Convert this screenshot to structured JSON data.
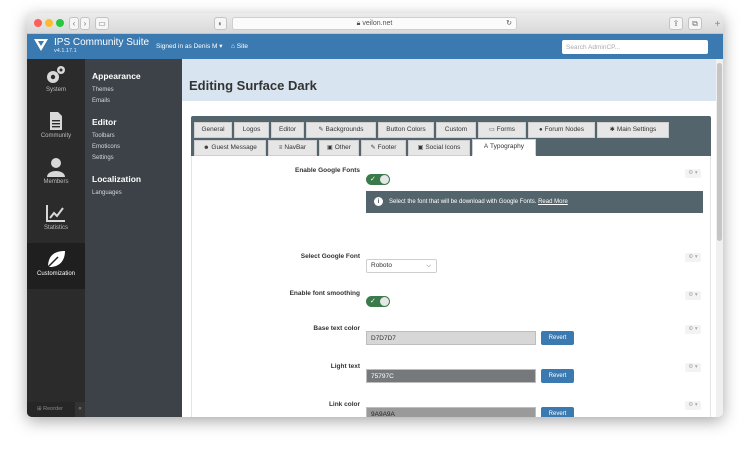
{
  "browser": {
    "url": "veilon.net",
    "tab_plus": "+"
  },
  "header": {
    "brand": "IPS Community Suite",
    "version": "v4.1.17.1",
    "signed_in": "Signed in as Denis M",
    "site_link": "Site",
    "search_placeholder": "Search AdminCP..."
  },
  "rail": {
    "items": [
      {
        "label": "System",
        "icon": "gears-icon"
      },
      {
        "label": "Community",
        "icon": "document-icon"
      },
      {
        "label": "Members",
        "icon": "user-icon"
      },
      {
        "label": "Statistics",
        "icon": "line-chart-icon"
      },
      {
        "label": "Customization",
        "icon": "leaf-icon"
      }
    ],
    "footer": "Reorder",
    "collapse": "«"
  },
  "submenu": {
    "appearance": "Appearance",
    "themes": "Themes",
    "emails": "Emails",
    "editor": "Editor",
    "toolbars": "Toolbars",
    "emoticons": "Emoticons",
    "settings": "Settings",
    "localization": "Localization",
    "languages": "Languages"
  },
  "page": {
    "title": "Editing Surface Dark"
  },
  "tabs": {
    "row1": [
      {
        "label": "General"
      },
      {
        "label": "Logos"
      },
      {
        "label": "Editor"
      },
      {
        "label": "Backgrounds",
        "icon": "✎"
      },
      {
        "label": "Button Colors"
      },
      {
        "label": "Custom"
      },
      {
        "label": "Forms",
        "icon": "▭"
      },
      {
        "label": "Forum Nodes",
        "icon": "●"
      },
      {
        "label": "Main Settings",
        "icon": "✱"
      }
    ],
    "row2": [
      {
        "label": "Guest Message",
        "icon": "☻"
      },
      {
        "label": "NavBar",
        "icon": "≡"
      },
      {
        "label": "Other",
        "icon": "▣"
      },
      {
        "label": "Footer",
        "icon": "✎"
      },
      {
        "label": "Social Icons",
        "icon": "▣"
      },
      {
        "label": "Typography",
        "icon": "A"
      }
    ]
  },
  "settings": {
    "google_fonts_label": "Enable Google Fonts",
    "info_text": "Select the font that will be download with Google Fonts.",
    "info_link": "Read More",
    "select_font_label": "Select Google Font",
    "select_font_value": "Roboto",
    "smoothing_label": "Enable font smoothing",
    "base_text_label": "Base text color",
    "base_text_value": "D7D7D7",
    "light_text_label": "Light text",
    "light_text_value": "75797C",
    "link_color_label": "Link color",
    "link_color_value": "9A9A9A",
    "revert": "Revert",
    "gear_mini": "⚙ ▾"
  },
  "colors": {
    "header_blue": "#3b7ab0",
    "tabbar": "#54646c",
    "toggle_on": "#3b7a4a",
    "base_text_swatch": "#d7d7d7",
    "light_text_swatch": "#75797c",
    "link_color_swatch": "#9a9a9a"
  }
}
